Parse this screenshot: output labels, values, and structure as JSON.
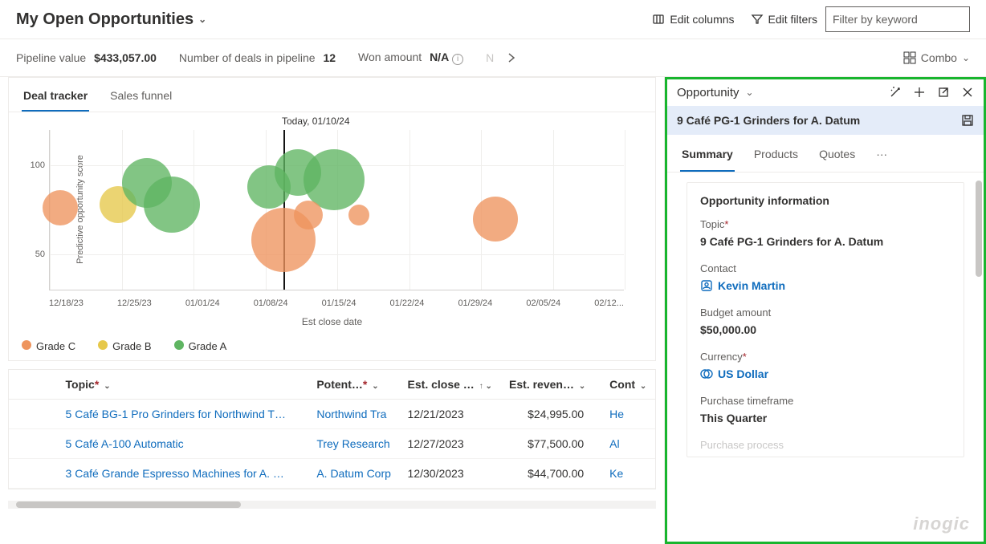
{
  "header": {
    "view_title": "My Open Opportunities",
    "edit_columns": "Edit columns",
    "edit_filters": "Edit filters",
    "filter_placeholder": "Filter by keyword"
  },
  "metrics": {
    "pipeline_label": "Pipeline value",
    "pipeline_value": "$433,057.00",
    "deals_label": "Number of deals in pipeline",
    "deals_value": "12",
    "won_label": "Won amount",
    "won_value": "N/A",
    "view_mode": "Combo"
  },
  "tabs": {
    "deal_tracker": "Deal tracker",
    "sales_funnel": "Sales funnel"
  },
  "chart_data": {
    "type": "bubble",
    "title": "",
    "today_label": "Today, 01/10/24",
    "xlabel": "Est close date",
    "ylabel": "Predictive opportunity score",
    "x_categories": [
      "12/18/23",
      "12/25/23",
      "01/01/24",
      "01/08/24",
      "01/15/24",
      "01/22/24",
      "01/29/24",
      "02/05/24",
      "02/12..."
    ],
    "y_ticks": [
      50,
      100
    ],
    "ylim": [
      30,
      120
    ],
    "today_index": 3.25,
    "grades": {
      "A": "#5fb562",
      "B": "#e6c84a",
      "C": "#ee945d"
    },
    "series": [
      {
        "grade": "C",
        "x": "12/19/23",
        "xi": 0.15,
        "y": 76,
        "size": 44
      },
      {
        "grade": "B",
        "x": "12/25/23",
        "xi": 0.95,
        "y": 78,
        "size": 46
      },
      {
        "grade": "A",
        "x": "12/28/23",
        "xi": 1.35,
        "y": 90,
        "size": 62
      },
      {
        "grade": "A",
        "x": "12/30/23",
        "xi": 1.7,
        "y": 78,
        "size": 70
      },
      {
        "grade": "A",
        "x": "01/09/24",
        "xi": 3.05,
        "y": 88,
        "size": 54
      },
      {
        "grade": "A",
        "x": "01/11/24",
        "xi": 3.45,
        "y": 96,
        "size": 58
      },
      {
        "grade": "A",
        "x": "01/15/24",
        "xi": 3.95,
        "y": 92,
        "size": 76
      },
      {
        "grade": "C",
        "x": "01/10/24",
        "xi": 3.25,
        "y": 58,
        "size": 80
      },
      {
        "grade": "C",
        "x": "01/13/24",
        "xi": 3.6,
        "y": 72,
        "size": 36
      },
      {
        "grade": "C",
        "x": "01/18/24",
        "xi": 4.3,
        "y": 72,
        "size": 26
      },
      {
        "grade": "C",
        "x": "02/06/24",
        "xi": 6.2,
        "y": 70,
        "size": 56
      }
    ],
    "legend": [
      {
        "label": "Grade C",
        "color": "#ee945d"
      },
      {
        "label": "Grade B",
        "color": "#e6c84a"
      },
      {
        "label": "Grade A",
        "color": "#5fb562"
      }
    ]
  },
  "grid": {
    "columns": {
      "topic": "Topic",
      "potential": "Potent…",
      "est_close": "Est. close …",
      "est_revenue": "Est. reven…",
      "contact": "Cont"
    },
    "rows": [
      {
        "topic": "5 Café BG-1 Pro Grinders for Northwind T…",
        "customer": "Northwind Tra",
        "close": "12/21/2023",
        "revenue": "$24,995.00",
        "contact": "He"
      },
      {
        "topic": "5 Café A-100 Automatic",
        "customer": "Trey Research",
        "close": "12/27/2023",
        "revenue": "$77,500.00",
        "contact": "Al"
      },
      {
        "topic": "3 Café Grande Espresso Machines for A. …",
        "customer": "A. Datum Corp",
        "close": "12/30/2023",
        "revenue": "$44,700.00",
        "contact": "Ke"
      }
    ]
  },
  "panel": {
    "entity": "Opportunity",
    "record_title": "9 Café PG-1 Grinders for A. Datum",
    "tabs": {
      "summary": "Summary",
      "products": "Products",
      "quotes": "Quotes"
    },
    "section_title": "Opportunity information",
    "fields": {
      "topic": {
        "label": "Topic",
        "required": true,
        "value": "9 Café PG-1 Grinders for A. Datum"
      },
      "contact": {
        "label": "Contact",
        "required": false,
        "value": "Kevin Martin",
        "lookup": true,
        "icon": "person"
      },
      "budget": {
        "label": "Budget amount",
        "required": false,
        "value": "$50,000.00"
      },
      "currency": {
        "label": "Currency",
        "required": true,
        "value": "US Dollar",
        "lookup": true,
        "icon": "currency"
      },
      "timeframe": {
        "label": "Purchase timeframe",
        "required": false,
        "value": "This Quarter"
      },
      "process": {
        "label": "Purchase process",
        "partial": true
      }
    }
  },
  "watermark": "inogic"
}
